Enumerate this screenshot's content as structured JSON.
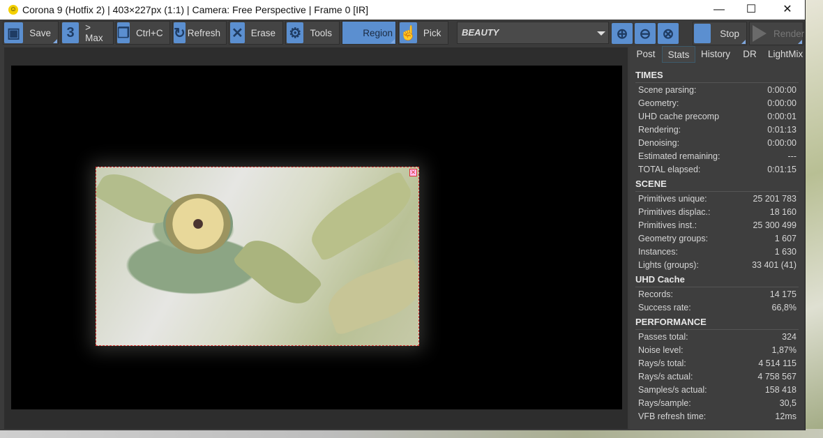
{
  "window": {
    "title": "Corona 9 (Hotfix 2) | 403×227px (1:1) | Camera: Free Perspective | Frame 0 [IR]",
    "minimize": "—",
    "maximize": "☐",
    "close": "✕"
  },
  "toolbar": {
    "save": "Save",
    "max": "> Max",
    "copy": "Ctrl+C",
    "refresh": "Refresh",
    "erase": "Erase",
    "tools": "Tools",
    "region": "Region",
    "pick": "Pick",
    "channel": "BEAUTY",
    "stop": "Stop",
    "render": "Render"
  },
  "tabs": [
    "Post",
    "Stats",
    "History",
    "DR",
    "LightMix"
  ],
  "stats": [
    {
      "title": "TIMES",
      "rows": [
        [
          "Scene parsing:",
          "0:00:00"
        ],
        [
          "Geometry:",
          "0:00:00"
        ],
        [
          "UHD cache precomp",
          "0:00:01"
        ],
        [
          "Rendering:",
          "0:01:13"
        ],
        [
          "Denoising:",
          "0:00:00"
        ],
        [
          "Estimated remaining:",
          "---"
        ],
        [
          "TOTAL elapsed:",
          "0:01:15"
        ]
      ]
    },
    {
      "title": "SCENE",
      "rows": [
        [
          "Primitives unique:",
          "25 201 783"
        ],
        [
          "Primitives displac.:",
          "18 160"
        ],
        [
          "Primitives inst.:",
          "25 300 499"
        ],
        [
          "Geometry groups:",
          "1 607"
        ],
        [
          "Instances:",
          "1 630"
        ],
        [
          "Lights (groups):",
          "33 401 (41)"
        ]
      ]
    },
    {
      "title": "UHD Cache",
      "rows": [
        [
          "Records:",
          "14 175"
        ],
        [
          "Success rate:",
          "66,8%"
        ]
      ]
    },
    {
      "title": "PERFORMANCE",
      "rows": [
        [
          "Passes total:",
          "324"
        ],
        [
          "Noise level:",
          "1,87%"
        ],
        [
          "Rays/s total:",
          "4 514 115"
        ],
        [
          "Rays/s actual:",
          "4 758 567"
        ],
        [
          "Samples/s actual:",
          "158 418"
        ],
        [
          "Rays/sample:",
          "30,5"
        ],
        [
          "VFB refresh time:",
          "12ms"
        ]
      ]
    }
  ]
}
